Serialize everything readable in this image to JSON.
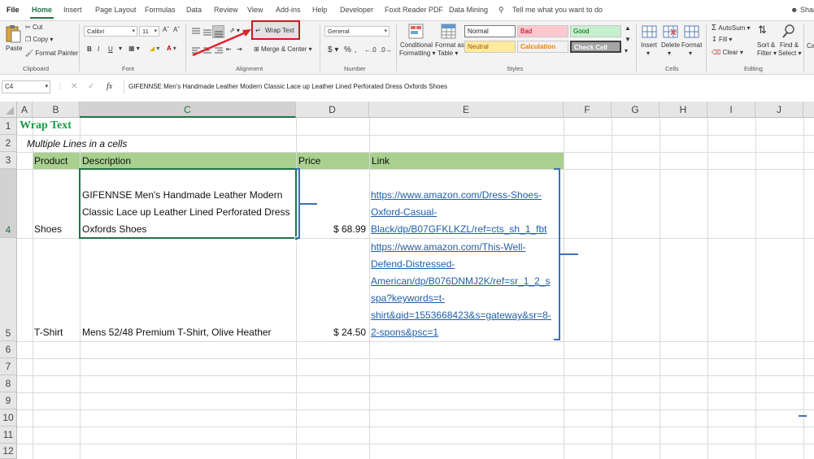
{
  "tabs": [
    "File",
    "Home",
    "Insert",
    "Page Layout",
    "Formulas",
    "Data",
    "Review",
    "View",
    "Add-ins",
    "Help",
    "Developer",
    "Foxit Reader PDF",
    "Data Mining"
  ],
  "active_tab": "Home",
  "tell_me": "Tell me what you want to do",
  "share": "Share",
  "ribbon": {
    "clipboard": {
      "paste": "Paste",
      "cut": "Cut",
      "copy": "Copy",
      "format_painter": "Format Painter",
      "label": "Clipboard"
    },
    "font": {
      "name": "Calibri",
      "size": "11",
      "label": "Font"
    },
    "alignment": {
      "wrap_text": "Wrap Text",
      "merge_center": "Merge & Center",
      "label": "Alignment"
    },
    "number": {
      "format": "General",
      "label": "Number",
      "currency": "$",
      "percent": "%"
    },
    "styles": {
      "conditional_formatting": "Conditional Formatting",
      "format_as_table": "Format as Table",
      "normal": "Normal",
      "bad": "Bad",
      "good": "Good",
      "neutral": "Neutral",
      "calculation": "Calculation",
      "check_cell": "Check Cell",
      "label": "Styles"
    },
    "cells": {
      "insert": "Insert",
      "delete": "Delete",
      "format": "Format",
      "label": "Cells"
    },
    "editing": {
      "autosum": "AutoSum",
      "fill": "Fill",
      "clear": "Clear",
      "sort_filter": "Sort & Filter",
      "find_select": "Find & Select",
      "label": "Editing"
    }
  },
  "formula_bar": {
    "name_box": "C4",
    "fx": "fx",
    "content": "GIFENNSE Men's Handmade Leather Modern Classic Lace up Leather Lined Perforated Dress Oxfords Shoes"
  },
  "columns": [
    "A",
    "B",
    "C",
    "D",
    "E",
    "F",
    "G",
    "H",
    "I",
    "J"
  ],
  "rows": [
    "1",
    "2",
    "3",
    "4",
    "5",
    "6",
    "7",
    "8",
    "9",
    "10",
    "11",
    "12"
  ],
  "sheet": {
    "title": "Wrap Text",
    "subtitle": "Multiple Lines in a cells",
    "headers": {
      "product": "Product",
      "description": "Description",
      "price": "Price",
      "link": "Link"
    },
    "row4": {
      "product": "Shoes",
      "description_lines": [
        "GIFENNSE Men's Handmade Leather Modern",
        "Classic Lace up Leather Lined Perforated Dress",
        "Oxfords Shoes"
      ],
      "price": "$ 68.99",
      "link_lines": [
        "https://www.amazon.com/Dress-Shoes-",
        "Oxford-Casual-",
        "Black/dp/B07GFKLKZL/ref=cts_sh_1_fbt"
      ]
    },
    "row5": {
      "product": "T-Shirt",
      "description": "Mens 52/48 Premium T-Shirt, Olive Heather",
      "price": "$ 24.50",
      "link_lines": [
        "https://www.amazon.com/This-Well-",
        "Defend-Distressed-",
        "American/dp/B076DNMJ2K/ref=sr_1_2_s",
        "spa?keywords=t-",
        "shirt&qid=1553668423&s=gateway&sr=8-",
        "2-spons&psc=1"
      ]
    }
  },
  "colors": {
    "excel_green": "#217346",
    "header_fill": "#a9d08e",
    "annotation_red": "#e0202a",
    "bracket_blue": "#3f6fb5",
    "link_blue": "#1f5ea8"
  }
}
